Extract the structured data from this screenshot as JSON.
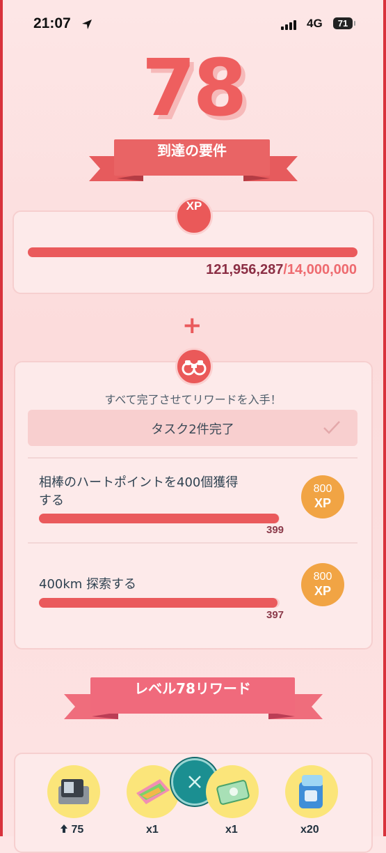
{
  "status_bar": {
    "time": "21:07",
    "network": "4G",
    "battery": "71",
    "location_icon": "location-arrow-icon",
    "signal_icon": "cellular-signal-icon"
  },
  "level": "78",
  "requirements_banner": "到達の要件",
  "xp_section": {
    "badge": "XP",
    "current": "121,956,287",
    "target": "/14,000,000",
    "progress": 1.0
  },
  "plus_sign": "+",
  "tasks_section": {
    "icon": "binoculars-icon",
    "caption": "すべて完了させてリワードを入手！",
    "completed_label": "タスク2件完了",
    "tasks": [
      {
        "title_line1": "相棒のハートポイントを400個獲得",
        "title_line2": "する",
        "value": "399",
        "progress": 0.9975,
        "reward_amount": "800",
        "reward_unit": "XP"
      },
      {
        "title_line1": "400km 探索する",
        "title_line2": "",
        "value": "397",
        "progress": 0.9925,
        "reward_amount": "800",
        "reward_unit": "XP"
      }
    ]
  },
  "rewards_banner": "レベル78リワード",
  "rewards": [
    {
      "icon": "incubator-icon",
      "count": "75"
    },
    {
      "icon": "candy-xl-icon",
      "count": "x1"
    },
    {
      "icon": "elite-pass-icon",
      "count": "x1"
    },
    {
      "icon": "storage-box-icon",
      "count": "x20"
    }
  ],
  "close_icon": "close-icon",
  "colors": {
    "accent_red": "#ea5a5c",
    "ribbon_red": "#e86565",
    "ribbon_pink": "#f06a7c",
    "xp_orange": "#f1a444",
    "close_teal": "#1b8f91"
  }
}
